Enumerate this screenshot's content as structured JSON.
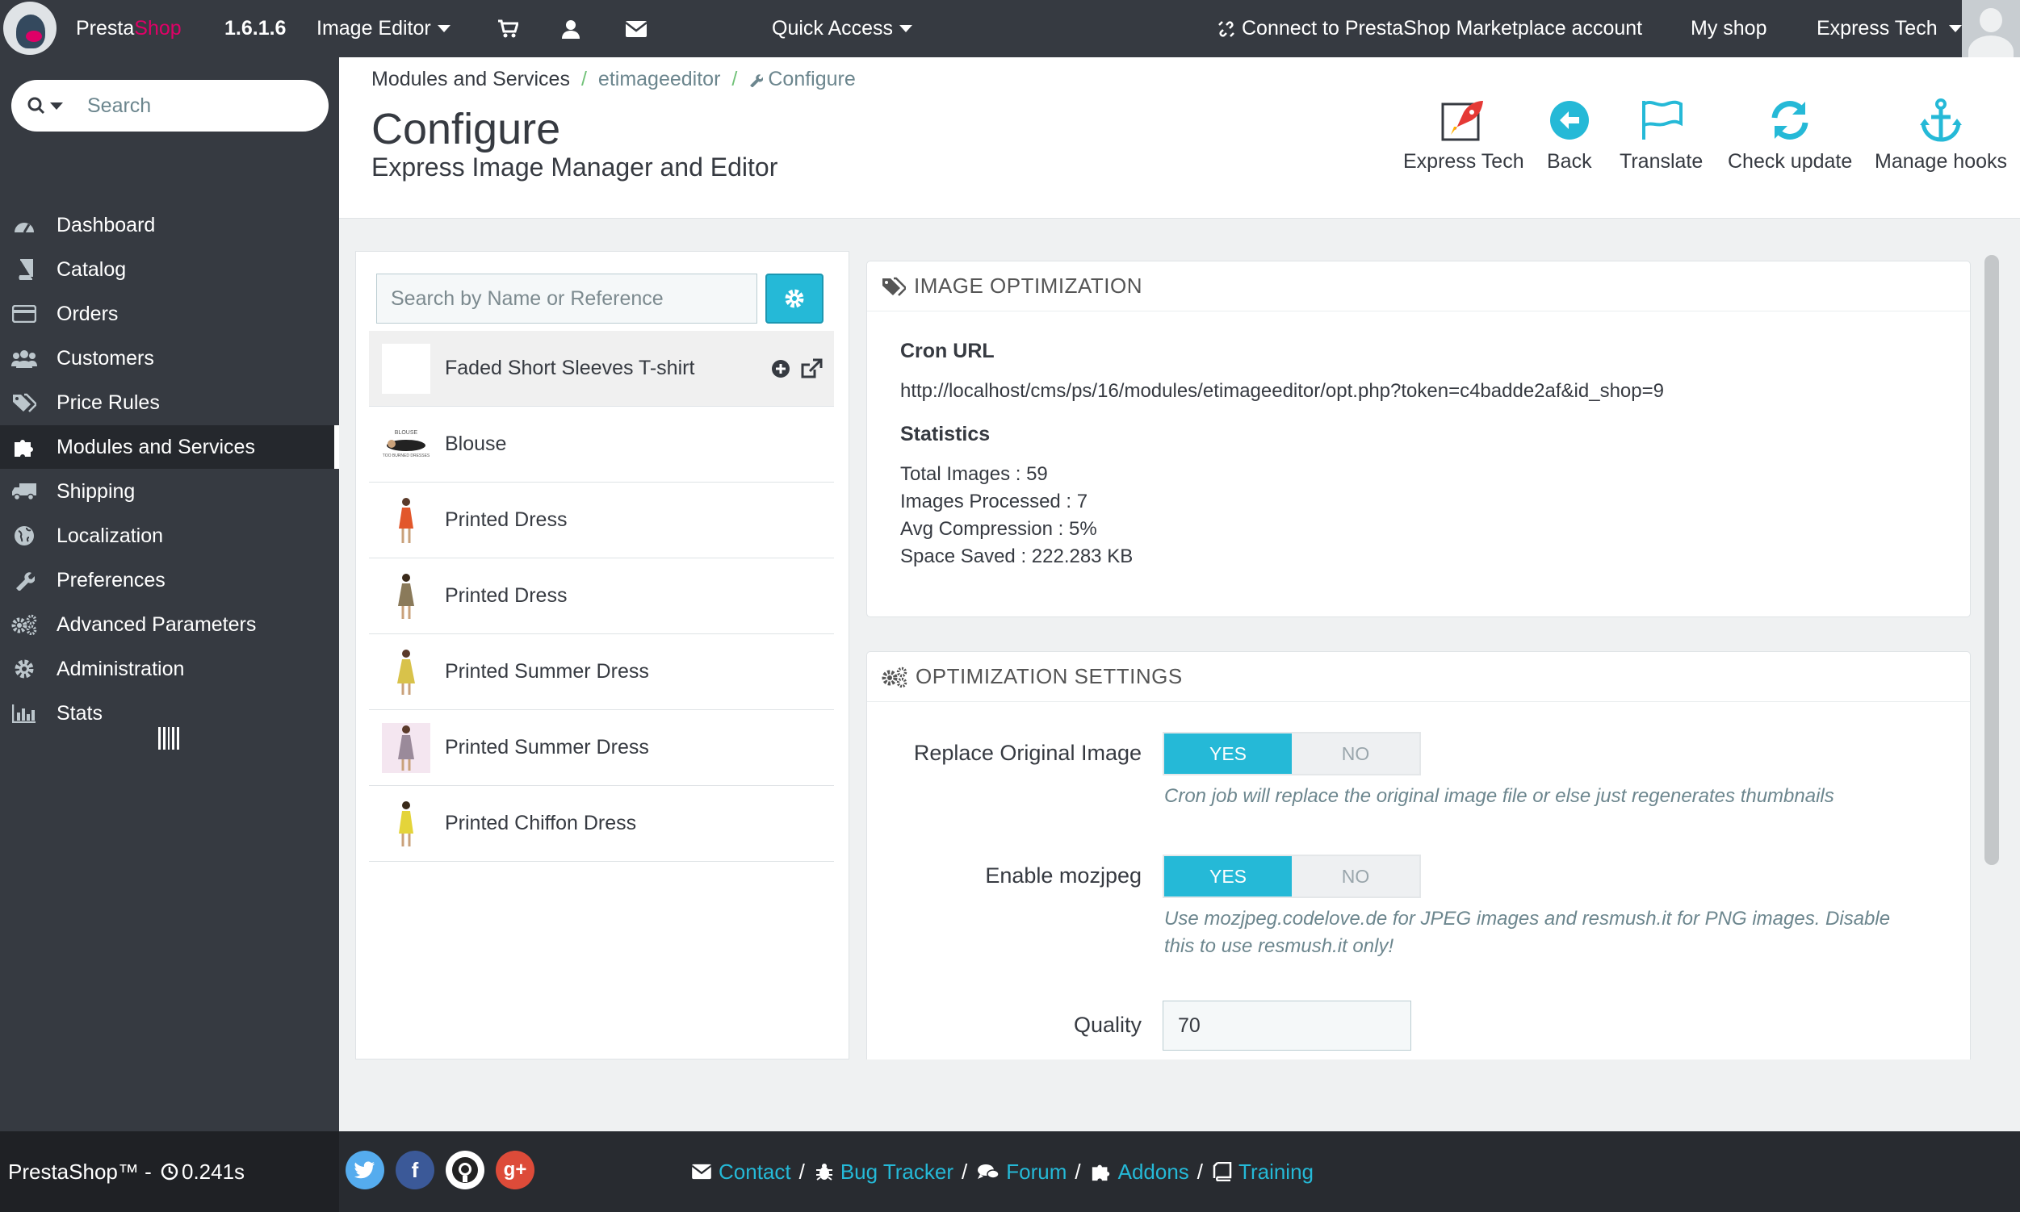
{
  "topbar": {
    "brand_presta": "Presta",
    "brand_shop": "Shop",
    "version": "1.6.1.6",
    "image_editor": "Image Editor",
    "quick_access": "Quick Access",
    "connect": "Connect to PrestaShop Marketplace account",
    "my_shop": "My shop",
    "user": "Express Tech"
  },
  "sidebar": {
    "search_placeholder": "Search",
    "items": [
      {
        "label": "Dashboard",
        "icon": "dashboard-icon"
      },
      {
        "label": "Catalog",
        "icon": "book-icon"
      },
      {
        "label": "Orders",
        "icon": "credit-card-icon"
      },
      {
        "label": "Customers",
        "icon": "users-icon"
      },
      {
        "label": "Price Rules",
        "icon": "tags-icon"
      },
      {
        "label": "Modules and Services",
        "icon": "puzzle-icon",
        "active": true
      },
      {
        "label": "Shipping",
        "icon": "truck-icon"
      },
      {
        "label": "Localization",
        "icon": "globe-icon"
      },
      {
        "label": "Preferences",
        "icon": "wrench-icon"
      },
      {
        "label": "Advanced Parameters",
        "icon": "cogs-icon"
      },
      {
        "label": "Administration",
        "icon": "gear-icon"
      },
      {
        "label": "Stats",
        "icon": "bar-chart-icon"
      }
    ]
  },
  "breadcrumb": {
    "root": "Modules and Services",
    "module": "etimageeditor",
    "current": "Configure"
  },
  "page": {
    "title": "Configure",
    "subtitle": "Express Image Manager and Editor"
  },
  "toolbar": {
    "express_tech": "Express Tech",
    "back": "Back",
    "translate": "Translate",
    "check_update": "Check update",
    "manage_hooks": "Manage hooks"
  },
  "products": {
    "search_placeholder": "Search by Name or Reference",
    "items": [
      {
        "name": "Faded Short Sleeves T-shirt"
      },
      {
        "name": "Blouse"
      },
      {
        "name": "Printed Dress"
      },
      {
        "name": "Printed Dress"
      },
      {
        "name": "Printed Summer Dress"
      },
      {
        "name": "Printed Summer Dress"
      },
      {
        "name": "Printed Chiffon Dress"
      }
    ],
    "blouse_thumb_top": "BLOUSE",
    "blouse_thumb_bottom": "TOO BURNED DRESSES"
  },
  "optimization": {
    "heading": "Image Optimization",
    "cron_label": "Cron URL",
    "cron_url": "http://localhost/cms/ps/16/modules/etimageeditor/opt.php?token=c4badde2af&id_shop=9",
    "stats_label": "Statistics",
    "total_images": "Total Images : 59",
    "images_processed": "Images Processed : 7",
    "avg_compression": "Avg Compression : 5%",
    "space_saved": "Space Saved : 222.283 KB"
  },
  "settings": {
    "heading": "Optimization Settings",
    "replace_label": "Replace Original Image",
    "replace_help": "Cron job will replace the original image file or else just regenerates thumbnails",
    "mozjpeg_label": "Enable mozjpeg",
    "mozjpeg_help_1": "Use mozjpeg.codelove.de for JPEG images and resmush.it for PNG images. Disable",
    "mozjpeg_help_2": "this to use resmush.it only!",
    "quality_label": "Quality",
    "quality_value": "70",
    "yes": "YES",
    "no": "NO"
  },
  "footer": {
    "brand": "PrestaShop™",
    "separator": " - ",
    "time": "0.241s",
    "contact": "Contact",
    "bug_tracker": "Bug Tracker",
    "forum": "Forum",
    "addons": "Addons",
    "training": "Training",
    "slash": "/"
  },
  "colors": {
    "accent": "#25b9d7",
    "topbar": "#363a41",
    "brand_pink": "#df0067",
    "breadcrumb_sep": "#72c279"
  }
}
